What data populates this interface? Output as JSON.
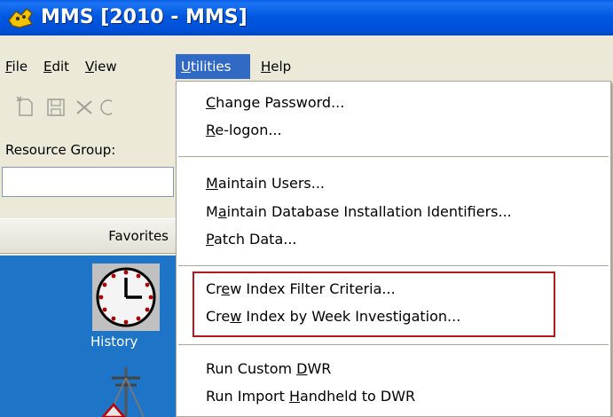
{
  "window": {
    "title": "MMS [2010 - MMS]"
  },
  "menubar": {
    "items": [
      {
        "label": "File",
        "mnemonic": "F",
        "rest": "ile"
      },
      {
        "label": "Edit",
        "mnemonic": "E",
        "rest": "dit"
      },
      {
        "label": "View",
        "mnemonic": "V",
        "rest": "iew"
      },
      {
        "label": "Utilities",
        "mnemonic": "U",
        "rest": "tilities"
      },
      {
        "label": "Help",
        "mnemonic": "H",
        "rest": "elp"
      }
    ]
  },
  "left": {
    "resource_group_label": "Resource Group:",
    "resource_group_value": "",
    "favorites_label": "Favorites",
    "history_label": "History"
  },
  "dropdown": {
    "groups": [
      [
        {
          "pre": "",
          "mn": "C",
          "post": "hange Password..."
        },
        {
          "pre": "",
          "mn": "R",
          "post": "e-logon..."
        }
      ],
      [
        {
          "pre": "",
          "mn": "M",
          "post": "aintain Users..."
        },
        {
          "pre": "M",
          "mn": "a",
          "post": "intain Database Installation Identifiers..."
        },
        {
          "pre": "",
          "mn": "P",
          "post": "atch Data..."
        }
      ],
      [
        {
          "pre": "Cr",
          "mn": "e",
          "post": "w Index Filter Criteria..."
        },
        {
          "pre": "Cre",
          "mn": "w",
          "post": " Index by Week Investigation..."
        }
      ],
      [
        {
          "pre": "Run Custom ",
          "mn": "D",
          "post": "WR"
        },
        {
          "pre": "Run Import ",
          "mn": "H",
          "post": "andheld to DWR"
        }
      ]
    ]
  },
  "colors": {
    "title_bar": "#0058e0",
    "menu_highlight": "#316ac5",
    "annotation_box": "#b11a1a",
    "panel": "#1e74c7"
  }
}
